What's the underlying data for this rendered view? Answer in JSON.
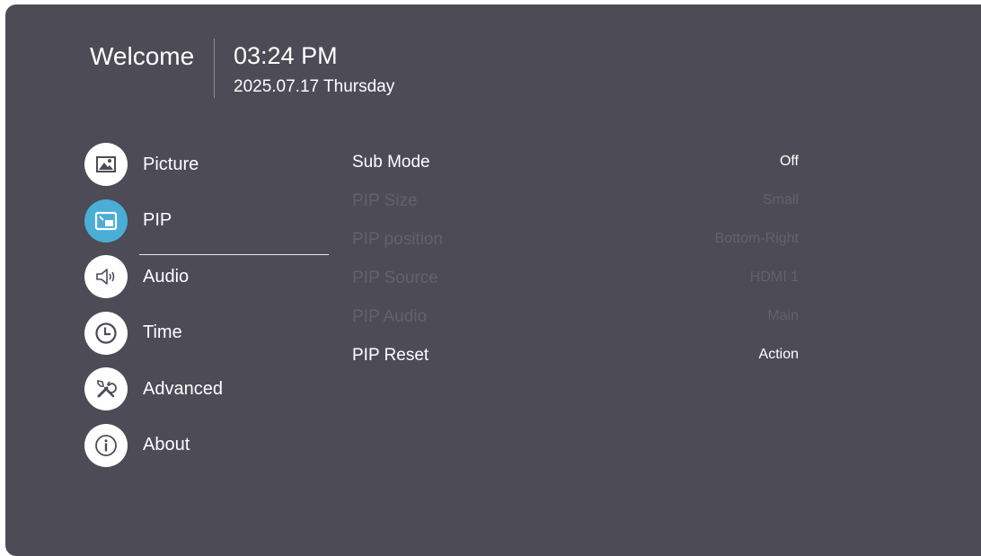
{
  "header": {
    "welcome": "Welcome",
    "time": "03:24 PM",
    "date": "2025.07.17 Thursday"
  },
  "menu": {
    "items": [
      {
        "label": "Picture",
        "icon": "picture-icon"
      },
      {
        "label": "PIP",
        "icon": "pip-icon",
        "active": true
      },
      {
        "label": "Audio",
        "icon": "speaker-icon"
      },
      {
        "label": "Time",
        "icon": "clock-icon"
      },
      {
        "label": "Advanced",
        "icon": "tools-icon"
      },
      {
        "label": "About",
        "icon": "info-icon"
      }
    ]
  },
  "settings": {
    "rows": [
      {
        "label": "Sub Mode",
        "value": "Off",
        "enabled": true
      },
      {
        "label": "PIP Size",
        "value": "Small",
        "enabled": false
      },
      {
        "label": "PIP position",
        "value": "Bottom-Right",
        "enabled": false
      },
      {
        "label": "PIP Source",
        "value": "HDMI 1",
        "enabled": false
      },
      {
        "label": "PIP Audio",
        "value": "Main",
        "enabled": false
      },
      {
        "label": "PIP Reset",
        "value": "Action",
        "enabled": true
      }
    ]
  },
  "colors": {
    "background": "#4c4b56",
    "accent": "#4aaed7",
    "disabled_text": "#62616d"
  }
}
